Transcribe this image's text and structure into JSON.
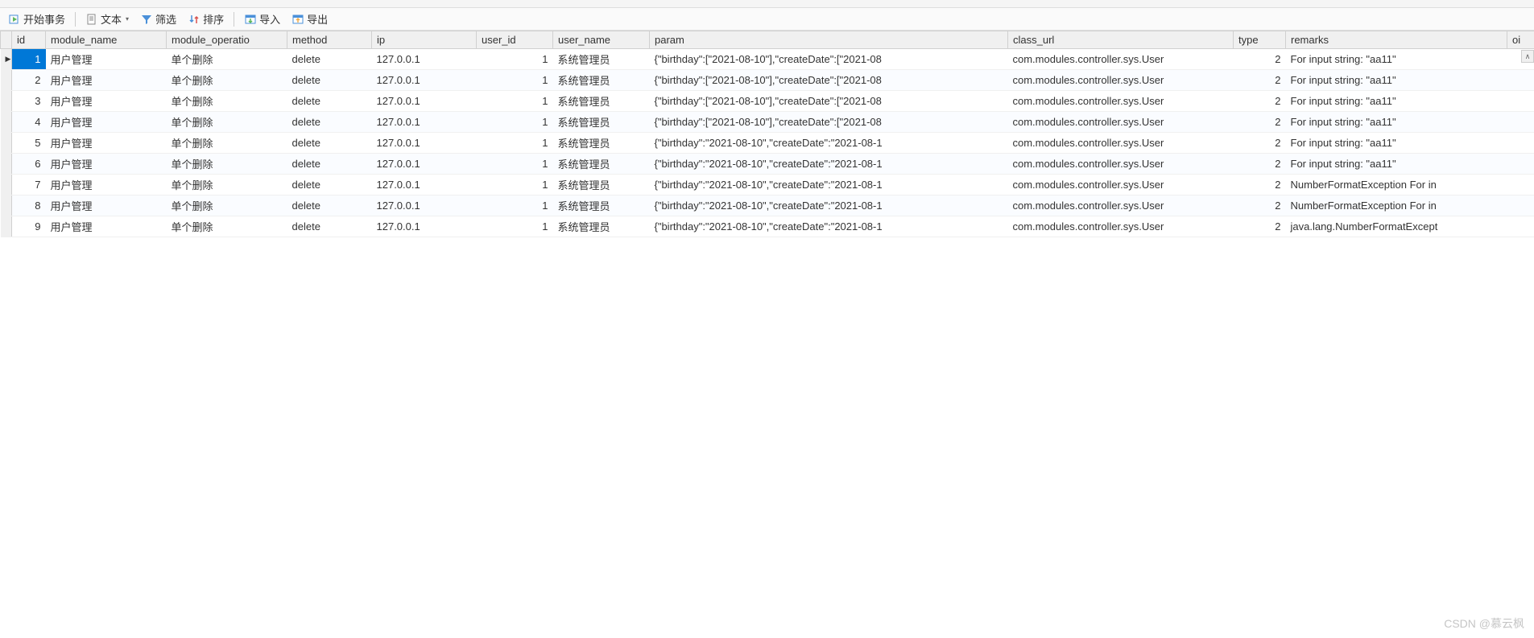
{
  "toolbar": {
    "start_transaction": "开始事务",
    "text": "文本",
    "filter": "筛选",
    "sort": "排序",
    "import": "导入",
    "export": "导出"
  },
  "columns": {
    "id": "id",
    "module_name": "module_name",
    "module_operation": "module_operatio",
    "method": "method",
    "ip": "ip",
    "user_id": "user_id",
    "user_name": "user_name",
    "param": "param",
    "class_url": "class_url",
    "type": "type",
    "remarks": "remarks",
    "oi": "oi"
  },
  "rows": [
    {
      "id": "1",
      "module_name": "用户管理",
      "module_operation": "单个删除",
      "method": "delete",
      "ip": "127.0.0.1",
      "user_id": "1",
      "user_name": "系统管理员",
      "param": "{\"birthday\":[\"2021-08-10\"],\"createDate\":[\"2021-08",
      "class_url": "com.modules.controller.sys.User",
      "type": "2",
      "remarks": "For input string: \"aa11\""
    },
    {
      "id": "2",
      "module_name": "用户管理",
      "module_operation": "单个删除",
      "method": "delete",
      "ip": "127.0.0.1",
      "user_id": "1",
      "user_name": "系统管理员",
      "param": "{\"birthday\":[\"2021-08-10\"],\"createDate\":[\"2021-08",
      "class_url": "com.modules.controller.sys.User",
      "type": "2",
      "remarks": "For input string: \"aa11\""
    },
    {
      "id": "3",
      "module_name": "用户管理",
      "module_operation": "单个删除",
      "method": "delete",
      "ip": "127.0.0.1",
      "user_id": "1",
      "user_name": "系统管理员",
      "param": "{\"birthday\":[\"2021-08-10\"],\"createDate\":[\"2021-08",
      "class_url": "com.modules.controller.sys.User",
      "type": "2",
      "remarks": "For input string: \"aa11\""
    },
    {
      "id": "4",
      "module_name": "用户管理",
      "module_operation": "单个删除",
      "method": "delete",
      "ip": "127.0.0.1",
      "user_id": "1",
      "user_name": "系统管理员",
      "param": "{\"birthday\":[\"2021-08-10\"],\"createDate\":[\"2021-08",
      "class_url": "com.modules.controller.sys.User",
      "type": "2",
      "remarks": "For input string: \"aa11\""
    },
    {
      "id": "5",
      "module_name": "用户管理",
      "module_operation": "单个删除",
      "method": "delete",
      "ip": "127.0.0.1",
      "user_id": "1",
      "user_name": "系统管理员",
      "param": "{\"birthday\":\"2021-08-10\",\"createDate\":\"2021-08-1",
      "class_url": "com.modules.controller.sys.User",
      "type": "2",
      "remarks": "For input string: \"aa11\""
    },
    {
      "id": "6",
      "module_name": "用户管理",
      "module_operation": "单个删除",
      "method": "delete",
      "ip": "127.0.0.1",
      "user_id": "1",
      "user_name": "系统管理员",
      "param": "{\"birthday\":\"2021-08-10\",\"createDate\":\"2021-08-1",
      "class_url": "com.modules.controller.sys.User",
      "type": "2",
      "remarks": "For input string: \"aa11\""
    },
    {
      "id": "7",
      "module_name": "用户管理",
      "module_operation": "单个删除",
      "method": "delete",
      "ip": "127.0.0.1",
      "user_id": "1",
      "user_name": "系统管理员",
      "param": "{\"birthday\":\"2021-08-10\",\"createDate\":\"2021-08-1",
      "class_url": "com.modules.controller.sys.User",
      "type": "2",
      "remarks": "NumberFormatException For in"
    },
    {
      "id": "8",
      "module_name": "用户管理",
      "module_operation": "单个删除",
      "method": "delete",
      "ip": "127.0.0.1",
      "user_id": "1",
      "user_name": "系统管理员",
      "param": "{\"birthday\":\"2021-08-10\",\"createDate\":\"2021-08-1",
      "class_url": "com.modules.controller.sys.User",
      "type": "2",
      "remarks": "NumberFormatException For in"
    },
    {
      "id": "9",
      "module_name": "用户管理",
      "module_operation": "单个删除",
      "method": "delete",
      "ip": "127.0.0.1",
      "user_id": "1",
      "user_name": "系统管理员",
      "param": "{\"birthday\":\"2021-08-10\",\"createDate\":\"2021-08-1",
      "class_url": "com.modules.controller.sys.User",
      "type": "2",
      "remarks": "java.lang.NumberFormatExcept"
    }
  ],
  "watermark": "CSDN @慕云枫"
}
